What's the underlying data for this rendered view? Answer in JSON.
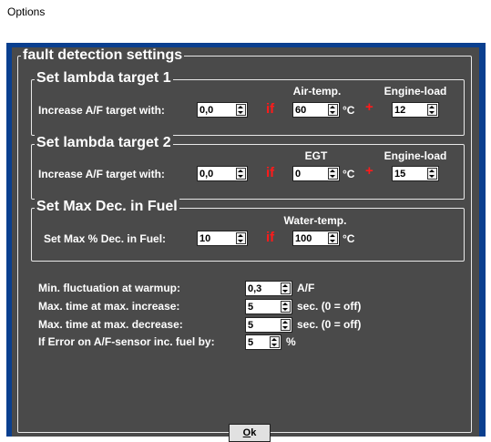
{
  "window": {
    "title": "Options"
  },
  "main_group": {
    "legend": "fault detection settings"
  },
  "lambda1": {
    "legend": "Set lambda target 1",
    "increase_label": "Increase A/F target with:",
    "increase_value": "0,0",
    "if_label": "if",
    "airtemp_header": "Air-temp.",
    "airtemp_value": "60",
    "airtemp_unit": "°C",
    "plus_label": "+",
    "engineload_header": "Engine-load",
    "engineload_value": "12"
  },
  "lambda2": {
    "legend": "Set lambda target 2",
    "increase_label": "Increase A/F target with:",
    "increase_value": "0,0",
    "if_label": "if",
    "egt_header": "EGT",
    "egt_value": "0",
    "egt_unit": "°C",
    "plus_label": "+",
    "engineload_header": "Engine-load",
    "engineload_value": "15"
  },
  "maxdec": {
    "legend": "Set Max Dec. in Fuel",
    "label": "Set Max % Dec. in Fuel:",
    "value": "10",
    "if_label": "if",
    "watertemp_header": "Water-temp.",
    "watertemp_value": "100",
    "watertemp_unit": "°C"
  },
  "misc": {
    "rows": [
      {
        "label": "Min. fluctuation at warmup:",
        "value": "0,3",
        "unit": "A/F"
      },
      {
        "label": "Max. time at max. increase:",
        "value": "5",
        "unit": "sec. (0 = off)"
      },
      {
        "label": "Max. time at max. decrease:",
        "value": "5",
        "unit": "sec. (0 = off)"
      },
      {
        "label": "If Error on A/F-sensor inc. fuel by:",
        "value": "5",
        "unit": "%"
      }
    ]
  },
  "ok_button": {
    "prefix": "",
    "accel": "O",
    "rest": "k"
  },
  "colors": {
    "panel": "#4a4a4a",
    "frame": "#0a3f8f",
    "accent_red": "#ff1a1a"
  }
}
